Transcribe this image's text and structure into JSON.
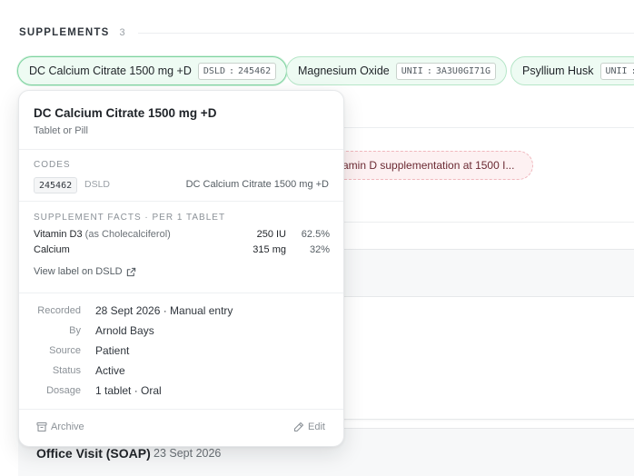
{
  "section": {
    "title": "SUPPLEMENTS",
    "count": "3"
  },
  "chips": [
    {
      "name": "DC Calcium Citrate 1500 mg +D",
      "system": "DSLD",
      "code": "245462"
    },
    {
      "name": "Magnesium Oxide",
      "system": "UNII",
      "code": "3A3U0GI71G"
    },
    {
      "name": "Psyllium Husk",
      "system": "UNII",
      "code": ""
    }
  ],
  "background": {
    "pill_text": "itamin D supplementation at 1500 I...",
    "visit_title": "Office Visit (SOAP)",
    "visit_date": "23 Sept 2026"
  },
  "popover": {
    "title": "DC Calcium Citrate 1500 mg +D",
    "subtitle": "Tablet or Pill",
    "codes_label": "CODES",
    "code": {
      "value": "245462",
      "system": "DSLD",
      "description": "DC Calcium Citrate 1500 mg +D"
    },
    "facts_label": "SUPPLEMENT FACTS · PER 1 TABLET",
    "facts": [
      {
        "name": "Vitamin D3",
        "form": "(as Cholecalciferol)",
        "amount": "250 IU",
        "dv": "62.5%"
      },
      {
        "name": "Calcium",
        "form": "",
        "amount": "315 mg",
        "dv": "32%"
      }
    ],
    "view_label": "View label on DSLD",
    "meta": [
      {
        "label": "Recorded",
        "value": "28 Sept 2026 · Manual entry"
      },
      {
        "label": "By",
        "value": "Arnold Bays"
      },
      {
        "label": "Source",
        "value": "Patient"
      },
      {
        "label": "Status",
        "value": "Active"
      },
      {
        "label": "Dosage",
        "value": "1 tablet · Oral"
      }
    ],
    "archive_label": "Archive",
    "edit_label": "Edit"
  },
  "icons": {
    "archive": "archive-icon",
    "edit": "pencil-icon",
    "external": "external-link-icon"
  }
}
